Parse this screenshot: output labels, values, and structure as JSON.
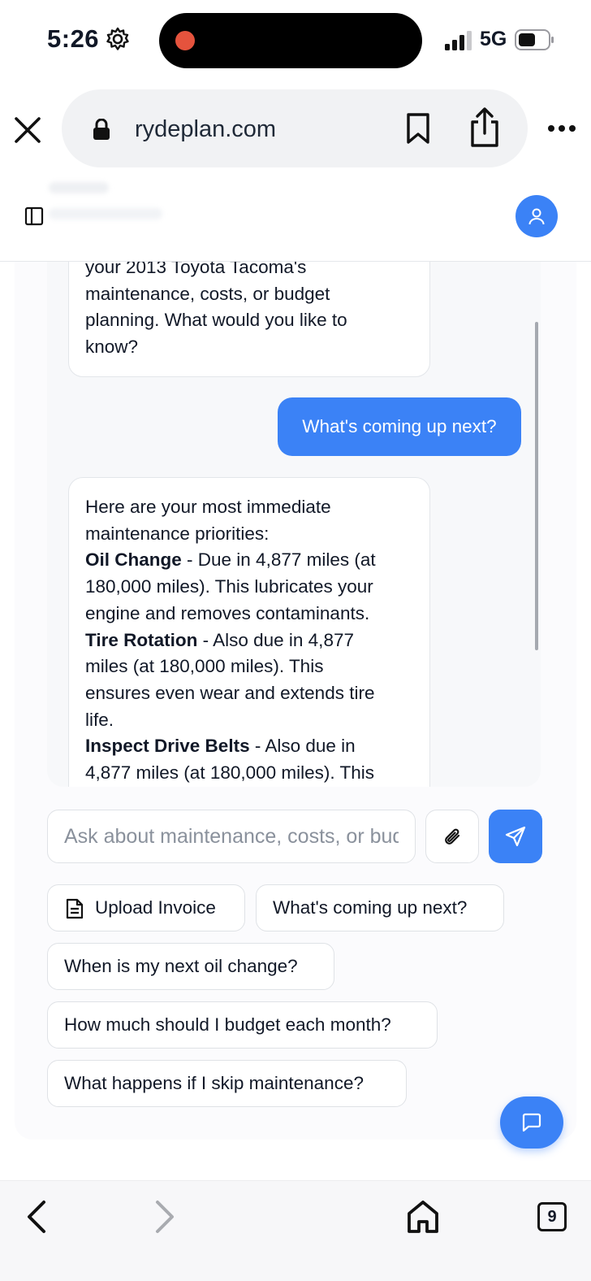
{
  "status_bar": {
    "time": "5:26",
    "network": "5G"
  },
  "browser": {
    "url": "rydeplan.com",
    "tab_count": "9"
  },
  "chat": {
    "messages": [
      {
        "role": "assistant",
        "lines": [
          "your 2013 Toyota Tacoma's",
          "maintenance, costs, or budget",
          "planning. What would you like to",
          "know?"
        ]
      },
      {
        "role": "user",
        "text": "What's coming up next?"
      },
      {
        "role": "assistant",
        "intro": [
          "Here are your most immediate",
          "maintenance priorities:"
        ],
        "items": [
          {
            "title": "Oil Change",
            "rest1": " - Due in 4,877 miles (at",
            "lines": [
              "180,000 miles). This lubricates your",
              "engine and removes contaminants."
            ]
          },
          {
            "title": "Tire Rotation",
            "rest1": " - Also due in 4,877",
            "lines": [
              "miles (at 180,000 miles). This",
              "ensures even wear and extends tire",
              "life."
            ]
          },
          {
            "title": "Inspect Drive Belts",
            "rest1": " - Also due in",
            "lines": [
              "4,877 miles (at 180,000 miles). This"
            ]
          }
        ]
      }
    ]
  },
  "composer": {
    "placeholder": "Ask about maintenance, costs, or budget..."
  },
  "suggestions": {
    "upload": "Upload Invoice",
    "next": "What's coming up next?",
    "oil": "When is my next oil change?",
    "budget": "How much should I budget each month?",
    "skip": "What happens if I skip maintenance?"
  },
  "colors": {
    "accent": "#3b82f6",
    "record": "#e5533d"
  },
  "icons": [
    "gear-icon",
    "signal-icon",
    "battery-icon",
    "close-icon",
    "lock-icon",
    "bookmark-icon",
    "share-icon",
    "more-icon",
    "sidebar-toggle-icon",
    "user-icon",
    "paperclip-icon",
    "send-icon",
    "document-icon",
    "chat-icon",
    "back-icon",
    "forward-icon",
    "home-icon"
  ]
}
